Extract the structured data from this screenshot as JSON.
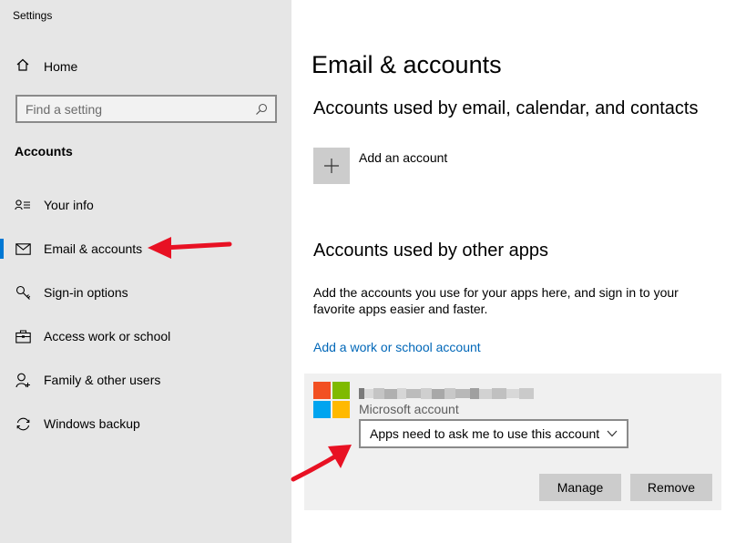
{
  "app": {
    "title": "Settings"
  },
  "sidebar": {
    "home_label": "Home",
    "search_placeholder": "Find a setting",
    "section_label": "Accounts",
    "items": [
      {
        "label": "Your info",
        "icon": "person-card-icon",
        "active": false
      },
      {
        "label": "Email & accounts",
        "icon": "mail-icon",
        "active": true
      },
      {
        "label": "Sign-in options",
        "icon": "key-icon",
        "active": false
      },
      {
        "label": "Access work or school",
        "icon": "briefcase-icon",
        "active": false
      },
      {
        "label": "Family & other users",
        "icon": "person-add-icon",
        "active": false
      },
      {
        "label": "Windows backup",
        "icon": "sync-icon",
        "active": false
      }
    ]
  },
  "main": {
    "title": "Email & accounts",
    "email_section_title": "Accounts used by email, calendar, and contacts",
    "add_account_label": "Add an account",
    "other_apps_title": "Accounts used by other apps",
    "other_apps_description": "Add the accounts you use for your apps here, and sign in to your favorite apps easier and faster.",
    "add_work_link": "Add a work or school account",
    "account": {
      "type": "Microsoft account",
      "permission_selected": "Apps need to ask me to use this account",
      "manage_label": "Manage",
      "remove_label": "Remove"
    }
  },
  "colors": {
    "sidebar_bg": "#e6e6e6",
    "accent": "#0078d4",
    "link": "#0067b8",
    "annotation_arrow": "#e81123",
    "ms_red": "#f25022",
    "ms_green": "#7fba00",
    "ms_blue": "#00a4ef",
    "ms_yellow": "#ffb900"
  }
}
